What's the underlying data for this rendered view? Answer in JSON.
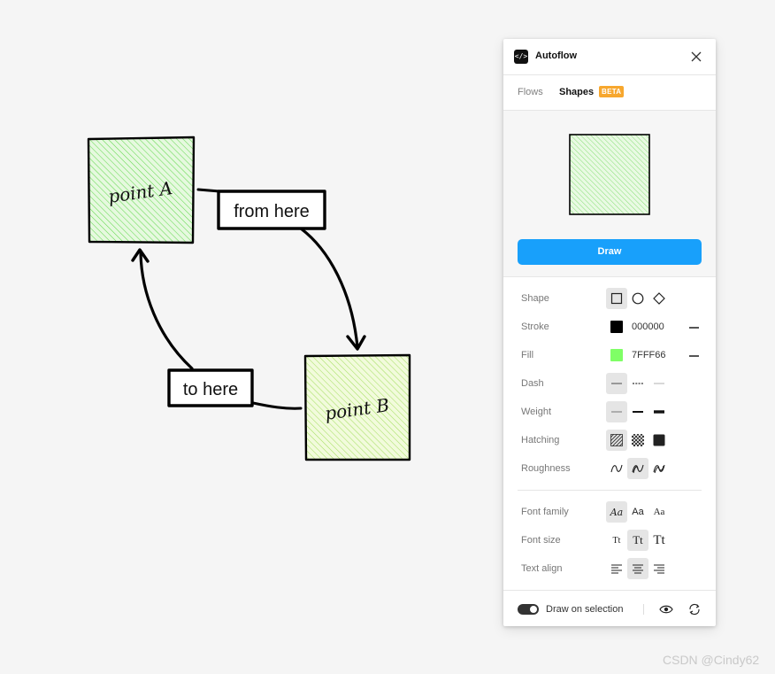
{
  "canvas": {
    "node_a": "point A",
    "node_b": "point B",
    "label_from": "from here",
    "label_to": "to here"
  },
  "panel": {
    "title": "Autoflow",
    "tabs": {
      "flows": "Flows",
      "shapes": "Shapes",
      "badge": "BETA"
    },
    "draw_button": "Draw",
    "props": {
      "shape": {
        "label": "Shape",
        "options": [
          "rectangle-icon",
          "ellipse-icon",
          "diamond-icon"
        ],
        "selected": "rectangle-icon"
      },
      "stroke": {
        "label": "Stroke",
        "color": "#000000",
        "hex": "000000"
      },
      "fill": {
        "label": "Fill",
        "color": "#7fff66",
        "hex": "7FFF66"
      },
      "dash": {
        "label": "Dash",
        "options": [
          "solid",
          "dashed",
          "dotted"
        ],
        "selected": "solid"
      },
      "weight": {
        "label": "Weight",
        "options": [
          "thin",
          "medium",
          "bold"
        ],
        "selected": "thin"
      },
      "hatching": {
        "label": "Hatching",
        "options": [
          "hachure",
          "cross-hatch",
          "solid"
        ],
        "selected": "hachure"
      },
      "roughness": {
        "label": "Roughness",
        "options": [
          "low",
          "medium",
          "high"
        ],
        "selected": "medium"
      },
      "font_family": {
        "label": "Font family",
        "samples": [
          "Aa",
          "Aa",
          "Aa"
        ],
        "selected": 0
      },
      "font_size": {
        "label": "Font size",
        "samples": [
          "Tt",
          "Tt",
          "Tt"
        ],
        "selected": 1
      },
      "text_align": {
        "label": "Text align",
        "options": [
          "left",
          "center",
          "right"
        ],
        "selected": "center"
      }
    },
    "footer": {
      "toggle_label": "Draw on selection",
      "toggle_on": true
    }
  },
  "watermark": "CSDN @Cindy62",
  "colors": {
    "accent": "#18a0fb",
    "badge": "#f7a72e",
    "node_a_fill": "#b9f0a8",
    "node_b_fill": "#e4f5b0"
  }
}
